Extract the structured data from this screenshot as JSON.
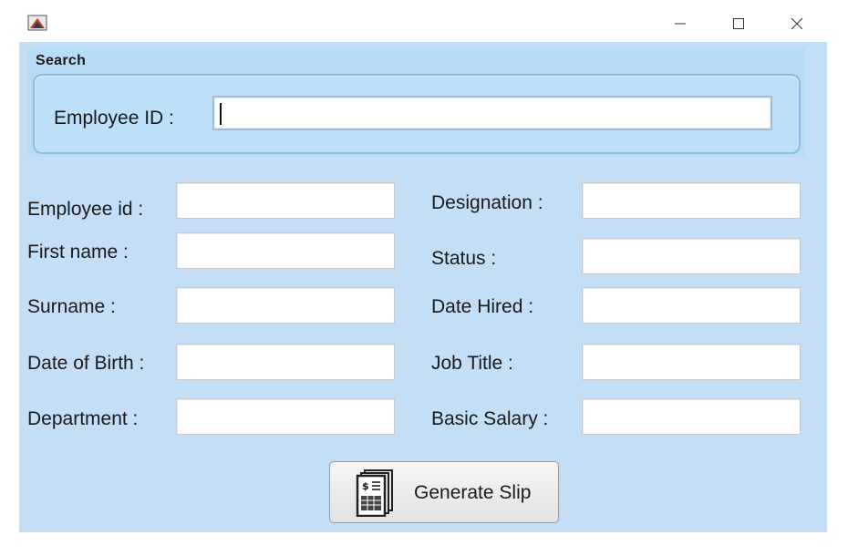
{
  "window": {
    "app_icon": "java-app-icon",
    "controls": {
      "minimize_icon": "minimize-icon",
      "maximize_icon": "maximize-icon",
      "close_icon": "close-icon"
    }
  },
  "search": {
    "title": "Search",
    "employee_id_label": "Employee ID :",
    "employee_id_value": ""
  },
  "form": {
    "left": [
      {
        "label": "Employee id :",
        "value": ""
      },
      {
        "label": "First name :",
        "value": ""
      },
      {
        "label": "Surname :",
        "value": ""
      },
      {
        "label": "Date of Birth :",
        "value": ""
      },
      {
        "label": "Department :",
        "value": ""
      }
    ],
    "right": [
      {
        "label": "Designation :",
        "value": ""
      },
      {
        "label": "Status :",
        "value": ""
      },
      {
        "label": "Date Hired :",
        "value": ""
      },
      {
        "label": "Job Title :",
        "value": ""
      },
      {
        "label": "Basic Salary :",
        "value": ""
      }
    ]
  },
  "generate_button": {
    "label": "Generate Slip",
    "icon": "payslip-icon",
    "icon_text": "$"
  },
  "colors": {
    "panel_bg": "#c3def5",
    "search_bg": "#bde0f8",
    "search_border": "#8fbbe0"
  }
}
